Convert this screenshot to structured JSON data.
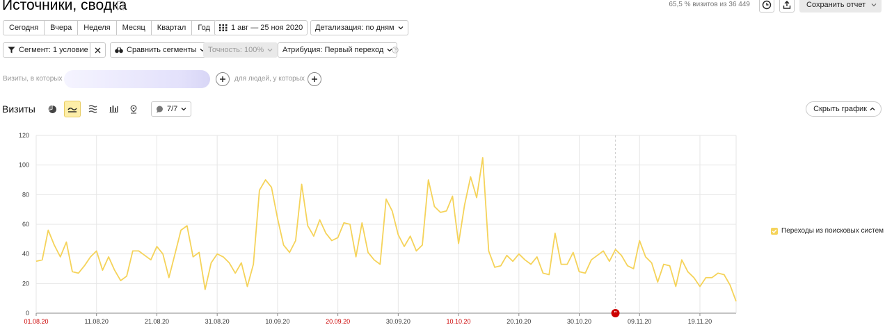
{
  "header": {
    "title": "Источники, сводка",
    "visits_summary": "65,5 % визитов из 36 449",
    "save_label": "Сохранить отчет"
  },
  "periods": [
    "Сегодня",
    "Вчера",
    "Неделя",
    "Месяц",
    "Квартал",
    "Год"
  ],
  "date_range": "1 авг — 25 ноя 2020",
  "detail": "Детализация: по дням",
  "filters": {
    "segment": "Сегмент: 1 условие",
    "compare": "Сравнить сегменты",
    "accuracy": "Точность: 100%",
    "attribution": "Атрибуция: Первый переход"
  },
  "condition": {
    "visits_label": "Визиты, в которых",
    "people_label": "для людей, у которых"
  },
  "chart_header": {
    "title": "Визиты",
    "metrics_count": "7/7",
    "hide_label": "Скрыть график"
  },
  "colors": {
    "series": "#f5d35a",
    "accent": "#fdeea8",
    "weekend": "#cc0000",
    "marker": "#cc0000"
  },
  "chart_data": {
    "type": "line",
    "title": "",
    "ylim": [
      0,
      120
    ],
    "yticks": [
      0,
      20,
      40,
      60,
      80,
      100,
      120
    ],
    "grid": true,
    "legend_position": "right",
    "x_start": "01.08.20",
    "x_end": "25.11.20",
    "xticks": [
      {
        "label": "01.08.20",
        "index": 0,
        "weekend": true
      },
      {
        "label": "11.08.20",
        "index": 10,
        "weekend": false
      },
      {
        "label": "21.08.20",
        "index": 20,
        "weekend": false
      },
      {
        "label": "31.08.20",
        "index": 30,
        "weekend": false
      },
      {
        "label": "10.09.20",
        "index": 40,
        "weekend": false
      },
      {
        "label": "20.09.20",
        "index": 50,
        "weekend": true
      },
      {
        "label": "30.09.20",
        "index": 60,
        "weekend": false
      },
      {
        "label": "10.10.20",
        "index": 70,
        "weekend": true
      },
      {
        "label": "20.10.20",
        "index": 80,
        "weekend": false
      },
      {
        "label": "30.10.20",
        "index": 90,
        "weekend": false
      },
      {
        "label": "09.11.20",
        "index": 100,
        "weekend": false
      },
      {
        "label": "19.11.20",
        "index": 110,
        "weekend": false
      }
    ],
    "annotation": {
      "date": "05.11.20",
      "index": 96
    },
    "series": [
      {
        "name": "Переходы из поисковых систем",
        "values": [
          35,
          36,
          56,
          46,
          38,
          48,
          28,
          27,
          32,
          38,
          42,
          29,
          38,
          29,
          22,
          25,
          42,
          42,
          39,
          36,
          45,
          40,
          24,
          40,
          56,
          59,
          38,
          41,
          16,
          34,
          40,
          38,
          34,
          27,
          34,
          18,
          33,
          83,
          90,
          85,
          64,
          46,
          41,
          49,
          87,
          59,
          52,
          63,
          54,
          49,
          51,
          61,
          60,
          38,
          61,
          41,
          36,
          33,
          77,
          69,
          53,
          45,
          52,
          42,
          46,
          90,
          72,
          68,
          69,
          79,
          47,
          73,
          92,
          78,
          105,
          42,
          31,
          32,
          39,
          35,
          40,
          36,
          33,
          38,
          27,
          26,
          54,
          33,
          33,
          41,
          28,
          27,
          36,
          39,
          42,
          35,
          43,
          39,
          32,
          30,
          49,
          38,
          34,
          21,
          33,
          32,
          18,
          36,
          28,
          24,
          18,
          24,
          24,
          27,
          26,
          19,
          8
        ]
      }
    ]
  }
}
